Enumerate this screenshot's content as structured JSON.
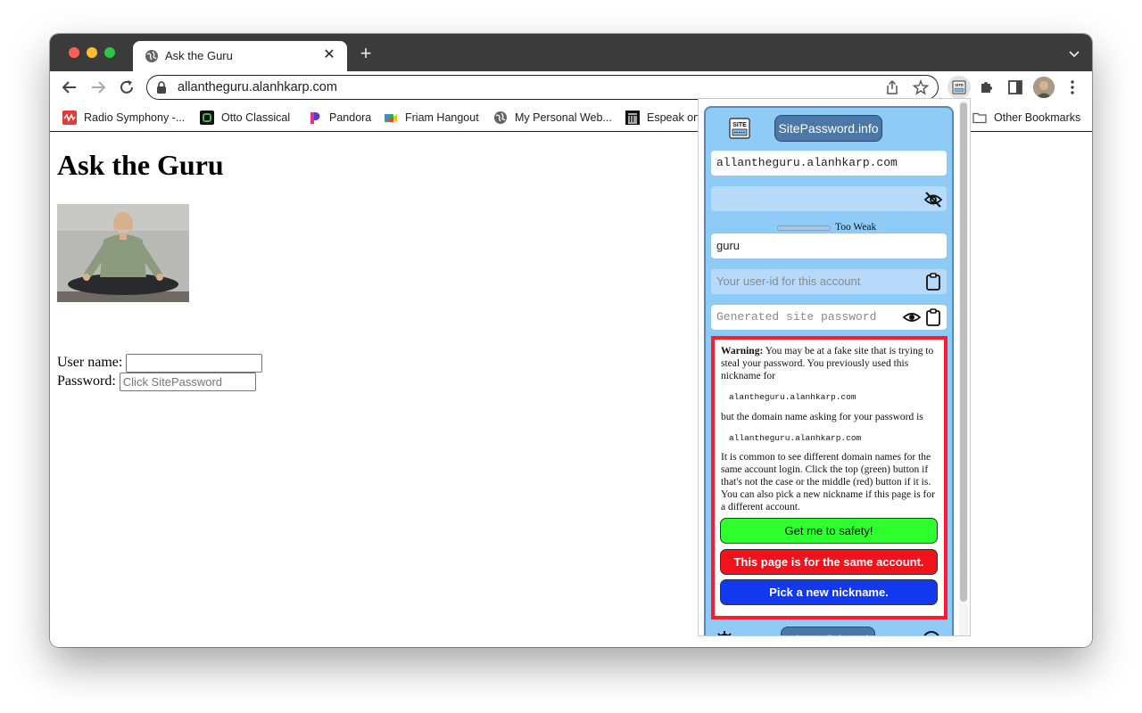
{
  "browser": {
    "tab": {
      "title": "Ask the Guru",
      "close": "✕"
    },
    "new_tab": "+",
    "url": "allantheguru.alanhkarp.com",
    "bookmarks": [
      {
        "label": "Radio Symphony -...",
        "icon": "radio-symphony-icon"
      },
      {
        "label": "Otto Classical",
        "icon": "otto-classical-icon"
      },
      {
        "label": "Pandora",
        "icon": "pandora-icon"
      },
      {
        "label": "Friam Hangout",
        "icon": "google-meet-icon"
      },
      {
        "label": "My Personal Web...",
        "icon": "globe-icon"
      },
      {
        "label": "Espeak on",
        "icon": "espeak-icon"
      }
    ],
    "other_bookmarks": "Other Bookmarks"
  },
  "page": {
    "heading": "Ask the Guru",
    "username_label": "User name:",
    "username_value": "",
    "password_label": "Password:",
    "password_placeholder": "Click SitePassword"
  },
  "popup": {
    "title_button": "SitePassword.info",
    "logo_text": "SITE",
    "domain": "allantheguru.alanhkarp.com",
    "super_password": "••••••",
    "strength": "Too Weak",
    "nickname": "guru",
    "userid_placeholder": "Your user-id for this account",
    "site_password_placeholder": "Generated site password",
    "warning": {
      "lead": "Warning:",
      "text1": " You may be at a fake site that is trying to steal your password. You previously used this nickname for",
      "domain1": "alantheguru.alanhkarp.com",
      "text2": "but the domain name asking for your password is",
      "domain2": "allantheguru.alanhkarp.com",
      "text3": "It is common to see different domain names for the same account login. Click the top (green) button if that's not the case or the middle (red) button if it is. You can also pick a new nickname if this page is for a different account.",
      "btn_safety": "Get me to safety!",
      "btn_same": "This page is for the same account.",
      "btn_nickname": "Pick a new nickname."
    },
    "footer_button": "Clear Clipboard",
    "colors": {
      "panel": "#8ecbf6",
      "warning_border": "#ff1a2e",
      "green": "#2eff2e",
      "red": "#f2121b",
      "blue": "#1238f0"
    }
  }
}
